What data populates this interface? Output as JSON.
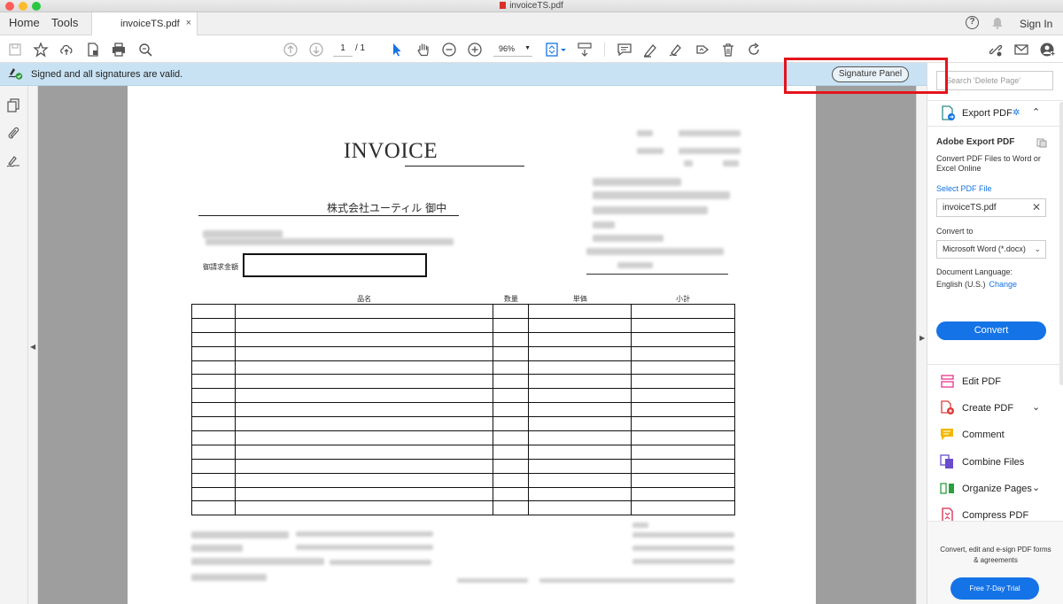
{
  "window": {
    "title": "invoiceTS.pdf"
  },
  "tabbar": {
    "home": "Home",
    "tools": "Tools",
    "doc_tab": "invoiceTS.pdf",
    "close": "×",
    "help": "?",
    "signin": "Sign In"
  },
  "toolbar": {
    "page_current": "1",
    "page_total": "/ 1",
    "zoom": "96%"
  },
  "infobar": {
    "message": "Signed and all signatures are valid.",
    "signature_panel": "Signature Panel"
  },
  "document": {
    "title": "INVOICE",
    "customer": "株式会社ユーティル 御中",
    "amount_label": "御請求金額",
    "table": {
      "headers": [
        "品名",
        "数量",
        "単価",
        "小計"
      ],
      "row_count": 15
    }
  },
  "right_panel": {
    "search_placeholder": "Search 'Delete Page'",
    "export_pdf": "Export PDF",
    "adobe_export_pdf": "Adobe Export PDF",
    "export_copy": "Convert PDF Files to Word or Excel Online",
    "select_pdf_file": "Select PDF File",
    "selected_file": "invoiceTS.pdf",
    "convert_to": "Convert to",
    "format": "Microsoft Word (*.docx)",
    "document_language": "Document Language:",
    "language": "English (U.S.)",
    "change": "Change",
    "convert": "Convert",
    "tools": [
      {
        "label": "Edit PDF",
        "color": "#e8358c"
      },
      {
        "label": "Create PDF",
        "color": "#e03a3a"
      },
      {
        "label": "Comment",
        "color": "#f5b800"
      },
      {
        "label": "Combine Files",
        "color": "#6a4ccc"
      },
      {
        "label": "Organize Pages",
        "color": "#2e9f3f"
      },
      {
        "label": "Compress PDF",
        "color": "#d6294f"
      }
    ],
    "footer_text": "Convert, edit and e-sign PDF forms & agreements",
    "trial": "Free 7-Day Trial"
  },
  "colors": {
    "accent": "#1473e6",
    "infobar": "#c9e2f3",
    "highlight": "#e4141b"
  }
}
